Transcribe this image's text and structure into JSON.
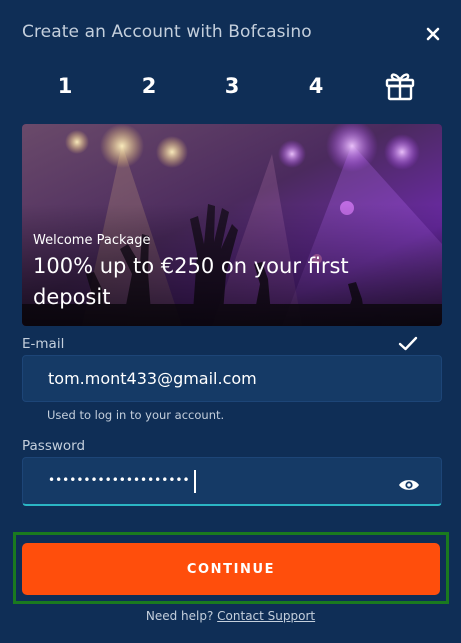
{
  "header": {
    "title": "Create an Account with Bofcasino"
  },
  "steps": {
    "items": [
      "1",
      "2",
      "3",
      "4"
    ],
    "final_icon": "gift-icon"
  },
  "banner": {
    "kicker": "Welcome Package",
    "headline": "100% up to €250 on your first deposit"
  },
  "email": {
    "label": "E-mail",
    "value": "tom.mont433@gmail.com",
    "hint": "Used to log in to your account.",
    "status_icon": "checkmark-icon"
  },
  "password": {
    "label": "Password",
    "masked_value": "••••••••••••••••••••",
    "toggle_icon": "eye-icon"
  },
  "actions": {
    "continue_label": "CONTINUE"
  },
  "footer": {
    "help_text": "Need help?",
    "support_link": "Contact Support"
  },
  "colors": {
    "background": "#0f2e56",
    "input_background": "#153a66",
    "accent_orange": "#ff4e0c",
    "focus_underline": "#2bb5c4",
    "highlight_border": "#1a7a1f"
  }
}
